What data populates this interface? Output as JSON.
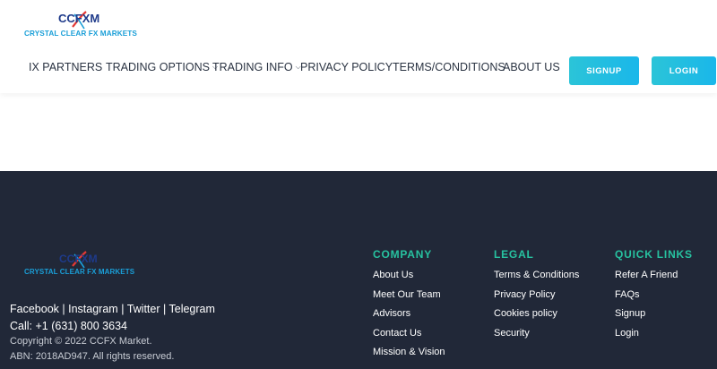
{
  "brand": {
    "mark_left": "CC",
    "mark_right": "FXM",
    "tagline": "CRYSTAL CLEAR FX MARKETS"
  },
  "colors": {
    "accent_teal": "#27c2a0",
    "button_gradient_start": "#2bc4d8",
    "button_gradient_end": "#1ab7ea",
    "footer_bg": "#212838",
    "tagline_blue": "#1a9fd8"
  },
  "nav": {
    "items": [
      {
        "label": "IX PARTNERS",
        "dropdown": false
      },
      {
        "label": "TRADING OPTIONS",
        "dropdown": true
      },
      {
        "label": "TRADING INFO",
        "dropdown": true
      },
      {
        "label": "PRIVACY POLICY",
        "dropdown": false
      },
      {
        "label": "TERMS/CONDITIONS",
        "dropdown": false
      },
      {
        "label": "ABOUT US",
        "dropdown": false
      }
    ],
    "chevron": "⌵",
    "signup_label": "SIGNUP",
    "login_label": "LOGIN"
  },
  "footer": {
    "social": [
      "Facebook",
      "Instagram",
      "Twitter",
      "Telegram"
    ],
    "social_separator": "|",
    "call": "Call: +1 (631) 800 3634",
    "copyright": "Copyright © 2022 CCFX Market.",
    "abn": "ABN: 2018AD947. All rights reserved.",
    "columns": {
      "company": {
        "heading": "COMPANY",
        "links": [
          "About Us",
          "Meet Our Team",
          "Advisors",
          "Contact Us",
          "Mission & Vision"
        ]
      },
      "legal": {
        "heading": "LEGAL",
        "links": [
          "Terms & Conditions",
          "Privacy Policy",
          "Cookies policy",
          "Security"
        ]
      },
      "quick_links": {
        "heading": "QUICK LINKS",
        "links": [
          "Refer A Friend",
          "FAQs",
          "Signup",
          "Login"
        ]
      }
    }
  }
}
